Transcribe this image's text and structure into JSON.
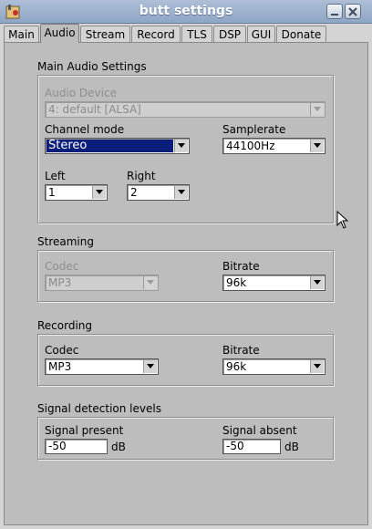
{
  "window": {
    "title": "butt settings",
    "buttons": {
      "minimize": "minimize-icon",
      "maximize": "maximize-icon",
      "close": "close-icon"
    }
  },
  "tabs": [
    {
      "label": "Main"
    },
    {
      "label": "Audio",
      "active": true
    },
    {
      "label": "Stream"
    },
    {
      "label": "Record"
    },
    {
      "label": "TLS"
    },
    {
      "label": "DSP"
    },
    {
      "label": "GUI"
    },
    {
      "label": "Donate"
    }
  ],
  "main_audio": {
    "group_label": "Main Audio Settings",
    "audio_device": {
      "label": "Audio Device",
      "value": "4: default [ALSA]",
      "enabled": false
    },
    "channel_mode": {
      "label": "Channel mode",
      "value": "Stereo"
    },
    "samplerate": {
      "label": "Samplerate",
      "value": "44100Hz"
    },
    "left": {
      "label": "Left",
      "value": "1"
    },
    "right": {
      "label": "Right",
      "value": "2"
    }
  },
  "streaming": {
    "group_label": "Streaming",
    "codec": {
      "label": "Codec",
      "value": "MP3",
      "enabled": false
    },
    "bitrate": {
      "label": "Bitrate",
      "value": "96k"
    }
  },
  "recording": {
    "group_label": "Recording",
    "codec": {
      "label": "Codec",
      "value": "MP3"
    },
    "bitrate": {
      "label": "Bitrate",
      "value": "96k"
    }
  },
  "signal_detection": {
    "group_label": "Signal detection levels",
    "present": {
      "label": "Signal present",
      "value": "-50",
      "unit": "dB"
    },
    "absent": {
      "label": "Signal absent",
      "value": "-50",
      "unit": "dB"
    }
  },
  "colors": {
    "titlebar": "#9fb3cf",
    "selection": "#0b1f7a",
    "panel": "#bdbdbd"
  }
}
